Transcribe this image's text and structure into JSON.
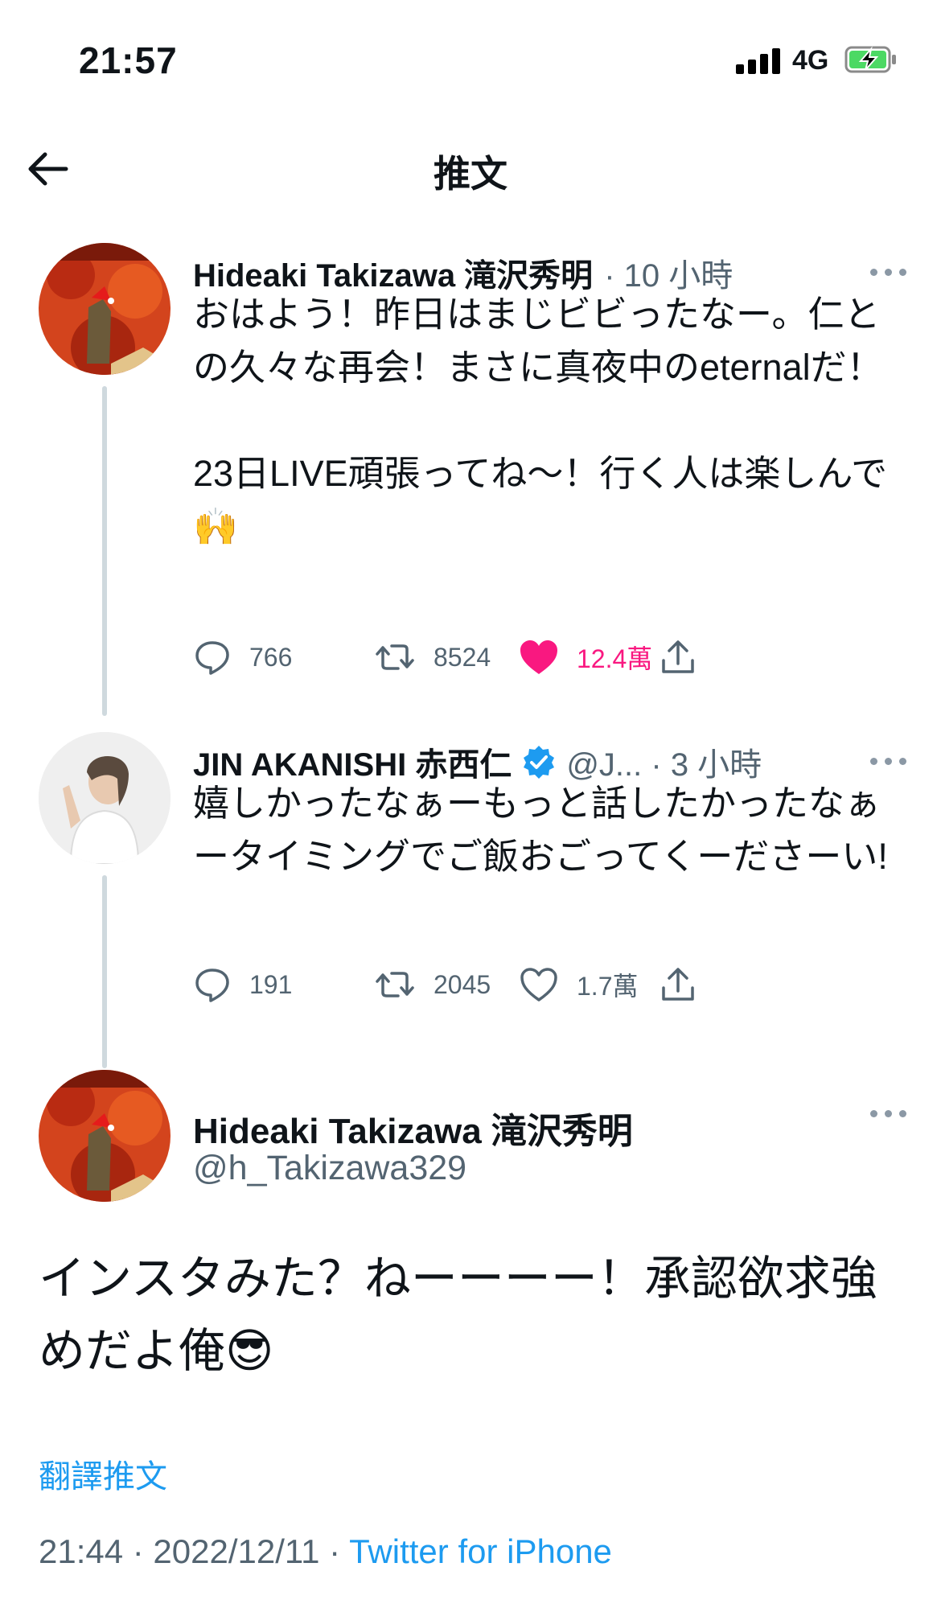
{
  "status_bar": {
    "time": "21:57",
    "network": "4G",
    "battery_state": "charging"
  },
  "nav": {
    "title": "推文"
  },
  "thread": [
    {
      "display_name": "Hideaki Takizawa 滝沢秀明",
      "meta": "· 10 小時",
      "text": "おはよう！昨日はまじビビったなー。仁との久々な再会！まさに真夜中のeternalだ！\n\n23日LIVE頑張ってね〜！行く人は楽しんで🙌",
      "replies": "766",
      "retweets": "8524",
      "likes": "12.4萬",
      "liked": true
    },
    {
      "display_name": "JIN AKANISHI 赤西仁",
      "verified": true,
      "meta": "@J... · 3 小時",
      "text": "嬉しかったなぁーもっと話したかったなぁータイミングでご飯おごってくーださーい!",
      "replies": "191",
      "retweets": "2045",
      "likes": "1.7萬",
      "liked": false
    }
  ],
  "main_tweet": {
    "display_name": "Hideaki Takizawa 滝沢秀明",
    "handle": "@h_Takizawa329",
    "text": "インスタみた？ねーーーー！承認欲求強めだよ俺😎",
    "translate_label": "翻譯推文",
    "timestamp": "21:44 · 2022/12/11 · ",
    "source": "Twitter for iPhone"
  },
  "colors": {
    "accent": "#1d9bf0",
    "like": "#f91880",
    "secondary_text": "#536471"
  }
}
